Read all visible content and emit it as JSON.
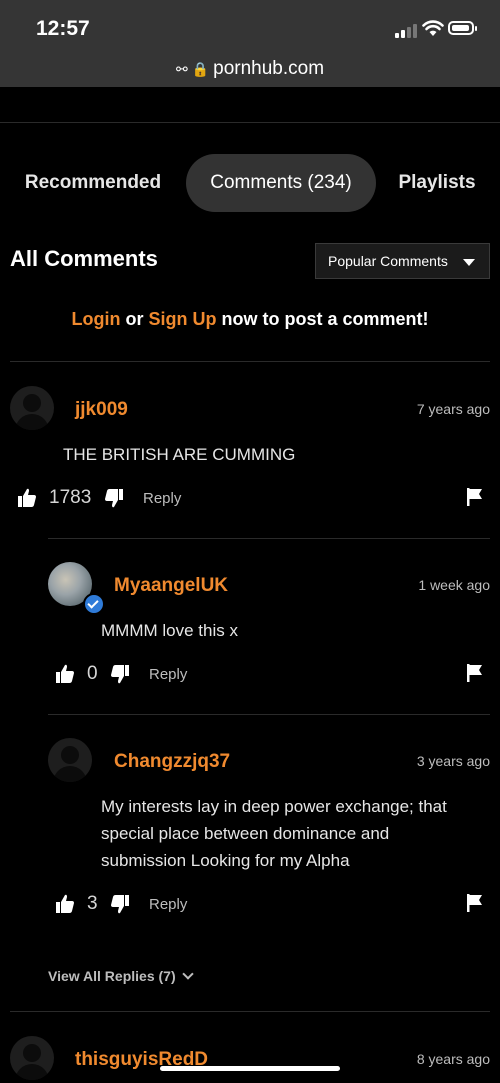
{
  "status_bar": {
    "time": "12:57"
  },
  "browser": {
    "url": "pornhub.com"
  },
  "tabs": [
    {
      "label": "Recommended"
    },
    {
      "label": "Comments (234)"
    },
    {
      "label": "Playlists"
    }
  ],
  "comments_section": {
    "title": "All Comments",
    "sort_selected": "Popular Comments",
    "login_prompt": {
      "login": "Login",
      "or": "or",
      "signup": "Sign Up",
      "rest": "now to post a comment!"
    }
  },
  "comments": [
    {
      "username": "jjk009",
      "age": "7 years ago",
      "text": "THE BRITISH ARE CUMMING",
      "likes": "1783",
      "reply_label": "Reply"
    },
    {
      "username": "MyaangelUK",
      "age": "1 week ago",
      "text": "MMMM love this x",
      "likes": "0",
      "reply_label": "Reply"
    },
    {
      "username": "Changzzjq37",
      "age": "3 years ago",
      "text_lines": [
        "My interests lay in deep power exchange; that",
        "special place between dominance and",
        "submission Looking for my Alpha"
      ],
      "likes": "3",
      "reply_label": "Reply"
    },
    {
      "username": "thisguyisRedD",
      "age": "8 years ago"
    }
  ],
  "view_all_replies": "View All Replies (7)"
}
